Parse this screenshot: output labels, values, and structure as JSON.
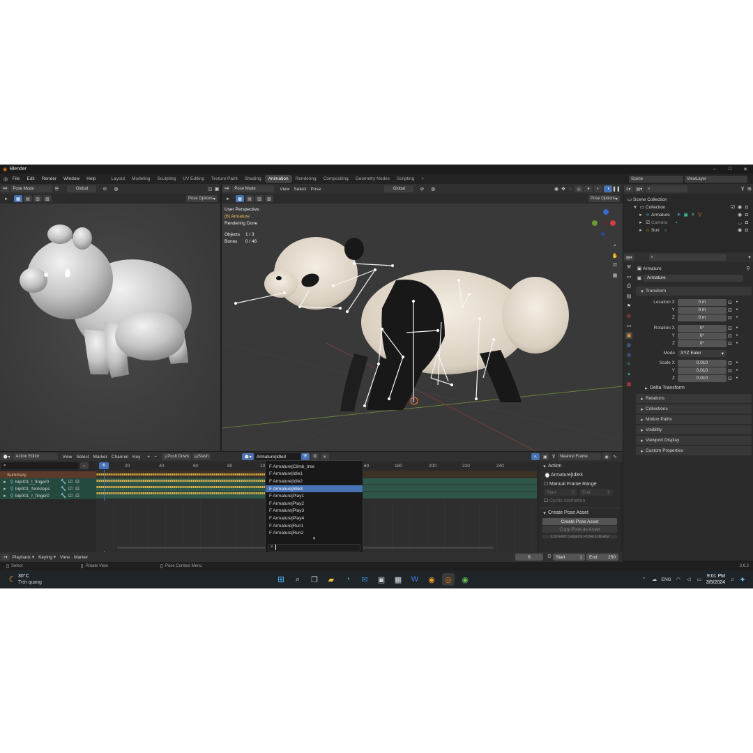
{
  "window": {
    "title": "Blender"
  },
  "menu": [
    "File",
    "Edit",
    "Render",
    "Window",
    "Help"
  ],
  "workspaces": [
    "Layout",
    "Modeling",
    "Sculpting",
    "UV Editing",
    "Texture Paint",
    "Shading",
    "Animation",
    "Rendering",
    "Compositing",
    "Geometry Nodes",
    "Scripting"
  ],
  "active_workspace": "Animation",
  "scene": {
    "name": "Scene",
    "view_layer": "ViewLayer"
  },
  "left_viewport": {
    "mode": "Pose Mode",
    "orientation": "Global",
    "pose_options": "Pose Options"
  },
  "main_viewport": {
    "mode": "Pose Mode",
    "menus": [
      "View",
      "Select",
      "Pose"
    ],
    "orientation": "Global",
    "pose_options": "Pose Options",
    "overlay": {
      "perspective": "User Perspective",
      "object": "(6) Armature",
      "status": "Rendering Done",
      "objects_label": "Objects",
      "objects_value": "1 / 3",
      "bones_label": "Bones",
      "bones_value": "0 / 46"
    }
  },
  "outliner": {
    "root": "Scene Collection",
    "collection": "Collection",
    "items": [
      {
        "name": "Armature",
        "color": "#d8d8d8"
      },
      {
        "name": "Camera",
        "color": "#8a8a8a"
      },
      {
        "name": "Sun",
        "color": "#d8d8d8"
      }
    ]
  },
  "properties": {
    "object": "Armature",
    "data": "Armature",
    "transform_title": "Transform",
    "location_label": "Location X",
    "location": [
      "0 m",
      "0 m",
      "0 m"
    ],
    "rotation_label": "Rotation X",
    "rotation": [
      "0°",
      "0°",
      "0°"
    ],
    "axis_y": "Y",
    "axis_z": "Z",
    "mode_label": "Mode",
    "mode_value": "XYZ Euler",
    "scale_label": "Scale X",
    "scale": [
      "0.010",
      "0.010",
      "0.010"
    ],
    "sections": [
      "Delta Transform",
      "Relations",
      "Collections",
      "Motion Paths",
      "Visibility",
      "Viewport Display",
      "Custom Properties"
    ]
  },
  "action_editor": {
    "mode": "Action Editor",
    "menus": [
      "View",
      "Select",
      "Marker",
      "Channel",
      "Key"
    ],
    "push_down": "Push Down",
    "stash": "Stash",
    "action_name": "Armature|Idle3",
    "snap": "Nearest Frame",
    "ruler": [
      "0",
      "20",
      "40",
      "60",
      "80",
      "10",
      "60",
      "180",
      "200",
      "220",
      "240"
    ],
    "current_frame": "6",
    "channels": [
      "Summary",
      "bip001_l_finger0",
      "bip001_footsteps",
      "bip001_r_finger0"
    ]
  },
  "action_dropdown": {
    "items": [
      "F Armature|Climb_tree",
      "F Armature|Idle1",
      "F Armature|Idle2",
      "F Armature|Idle3",
      "F Armature|Play1",
      "F Armature|Play2",
      "F Armature|Play3",
      "F Armature|Play4",
      "F Armature|Run1",
      "F Armature|Run2"
    ],
    "selected_index": 3
  },
  "action_sidebar": {
    "action_title": "Action",
    "action_name": "Armature|Idle3",
    "manual_range": "Manual Frame Range",
    "start_label": "Start",
    "start_value": "0",
    "end_label": "End",
    "end_value": "0",
    "cyclic": "Cyclic Animation",
    "pose_asset_title": "Create Pose Asset",
    "create_pose_asset": "Create Pose Asset",
    "copy_pose": "Copy Pose as Asset",
    "convert": "Convert Legacy Pose Library"
  },
  "timeline": {
    "menus": [
      "Playback",
      "Keying",
      "View",
      "Marker"
    ],
    "frame": "6",
    "start_label": "Start",
    "start": "1",
    "end_label": "End",
    "end": "250"
  },
  "status_bar": {
    "select": "Select",
    "rotate": "Rotate View",
    "context": "Pose Context Menu",
    "version": "3.6.2"
  },
  "taskbar": {
    "weather_temp": "30°C",
    "weather_desc": "Trời quang",
    "lang": "ENG",
    "time": "9:01 PM",
    "date": "3/5/2024"
  },
  "colors": {
    "accent": "#4772b3",
    "keyframe": "#e8b74a",
    "track_green": "#2f5749",
    "header": "#303030"
  }
}
